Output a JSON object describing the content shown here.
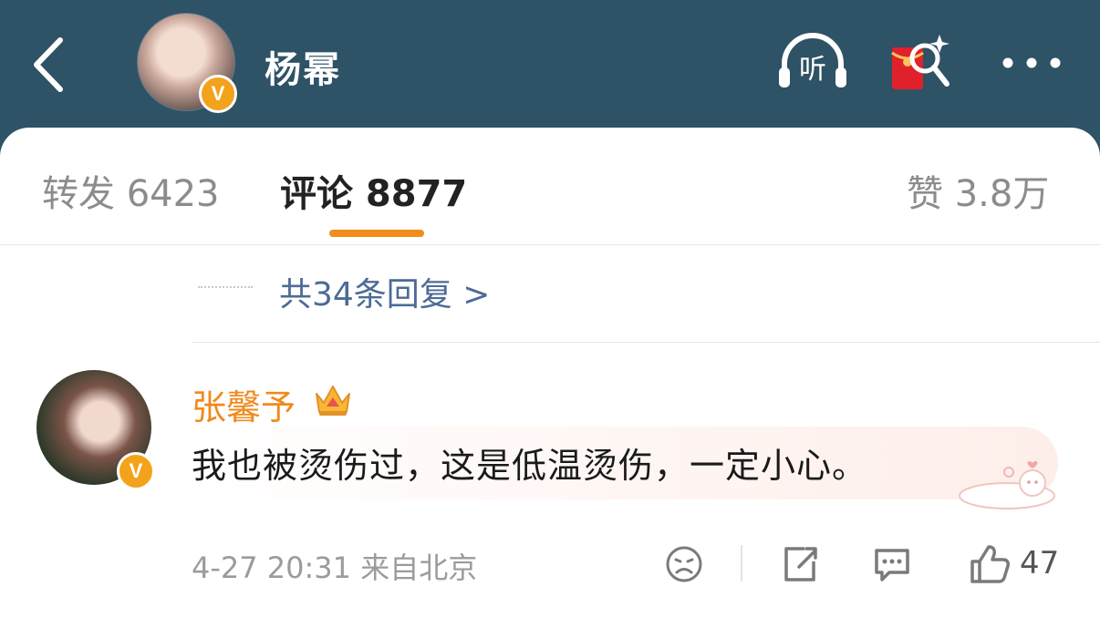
{
  "header": {
    "username": "杨幂",
    "listen_label": "听",
    "verified_badge": "V",
    "icons": [
      "back-arrow-icon",
      "listen-headphones-icon",
      "red-envelope-search-icon",
      "more-dots-icon"
    ]
  },
  "tabs": [
    {
      "label": "转发 6423",
      "active": false
    },
    {
      "label": "评论 8877",
      "active": true
    },
    {
      "label": "赞 3.8万",
      "active": false
    }
  ],
  "replies_link": "共34条回复 >",
  "comment": {
    "author": "张馨予",
    "verified_badge": "V",
    "text": "我也被烫伤过，这是低温烫伤，一定小心。",
    "timestamp": "4-27 20:31 来自北京",
    "like_count": "47"
  },
  "colors": {
    "header_bg": "#2e5266",
    "accent_orange": "#f28c1c",
    "link_blue": "#4d6b95",
    "verified_badge": "#f3a31b"
  }
}
